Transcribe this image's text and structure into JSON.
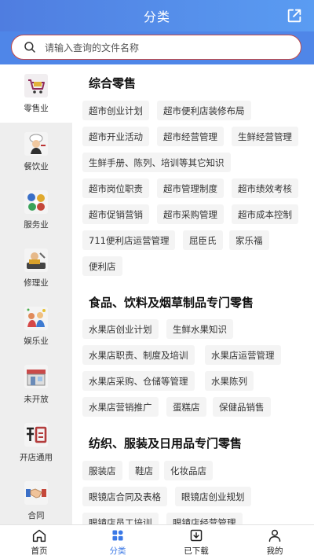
{
  "header": {
    "title": "分类"
  },
  "search": {
    "placeholder": "请输入查询的文件名称"
  },
  "sidebar": {
    "items": [
      {
        "label": "零售业",
        "icon": "cart-icon"
      },
      {
        "label": "餐饮业",
        "icon": "chef-icon"
      },
      {
        "label": "服务业",
        "icon": "gears-icon"
      },
      {
        "label": "修理业",
        "icon": "mechanic-icon"
      },
      {
        "label": "娱乐业",
        "icon": "party-icon"
      },
      {
        "label": "未开放",
        "icon": "storefront-icon"
      },
      {
        "label": "开店通用",
        "icon": "shop-sign-icon"
      },
      {
        "label": "合同",
        "icon": "handshake-icon"
      }
    ]
  },
  "content": {
    "sections": [
      {
        "title": "综合零售",
        "tags": [
          "超市创业计划",
          "超市便利店装修布局",
          "超市开业活动",
          "超市经营管理",
          "生鲜经营管理",
          "生鲜手册、陈列、培训等其它知识",
          "超市岗位职责",
          "超市管理制度",
          "超市绩效考核",
          "超市促销营销",
          "超市采购管理",
          "超市成本控制",
          "711便利店运营管理",
          "屈臣氏",
          "家乐福",
          "便利店"
        ]
      },
      {
        "title": "食品、饮料及烟草制品专门零售",
        "tags": [
          "水果店创业计划",
          "生鲜水果知识",
          "水果店职责、制度及培训",
          "水果店运营管理",
          "水果店采购、仓储等管理",
          "水果陈列",
          "水果店营销推广",
          "蛋糕店",
          "保健品销售"
        ]
      },
      {
        "title": "纺织、服装及日用品专门零售",
        "tags": [
          "服装店",
          "鞋店",
          "化妆品店",
          "眼镜店合同及表格",
          "眼镜店创业规划",
          "眼镜店员工培训",
          "眼镜店经营管理"
        ]
      }
    ]
  },
  "tabbar": {
    "items": [
      {
        "label": "首页",
        "icon": "home-icon"
      },
      {
        "label": "分类",
        "icon": "category-icon"
      },
      {
        "label": "已下载",
        "icon": "download-icon"
      },
      {
        "label": "我的",
        "icon": "profile-icon"
      }
    ]
  },
  "colors": {
    "accent": "#3a78e6",
    "header": "#4f86e8",
    "search_border": "#c24a4a"
  }
}
